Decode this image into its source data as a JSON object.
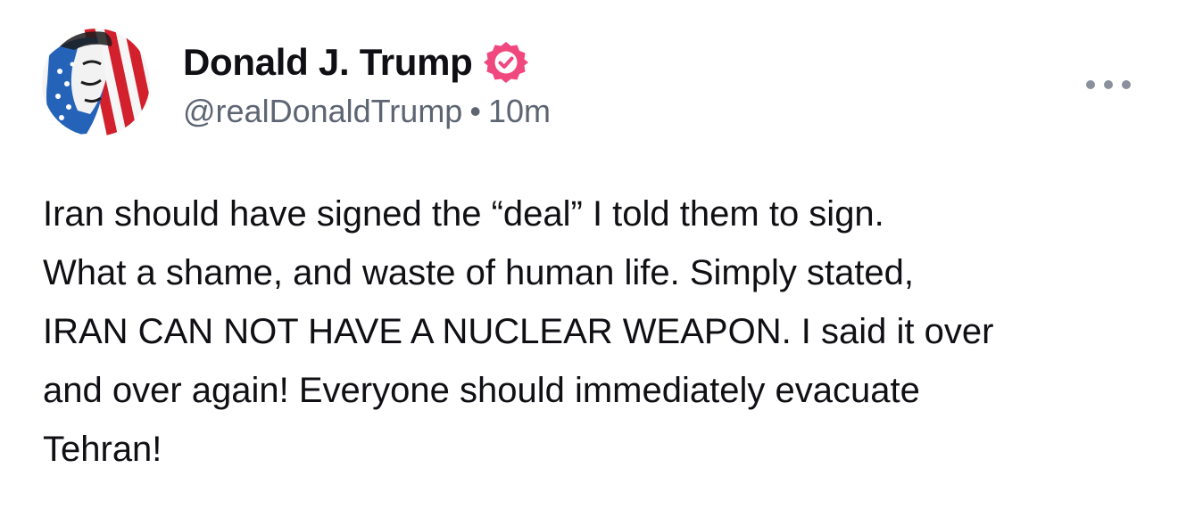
{
  "author": {
    "display_name": "Donald J. Trump",
    "handle": "@realDonaldTrump",
    "separator": "•",
    "time_ago": "10m",
    "verified_icon": "verified-badge-icon",
    "verified_color": "#f0477f"
  },
  "menu": {
    "icon": "more-options-icon"
  },
  "post": {
    "lines": [
      "Iran should have signed the “deal” I told them to sign.",
      "What a shame, and waste of human life. Simply stated,",
      "IRAN CAN NOT HAVE A NUCLEAR WEAPON. I said it over",
      "and over again! Everyone should immediately evacuate",
      "Tehran!"
    ]
  }
}
